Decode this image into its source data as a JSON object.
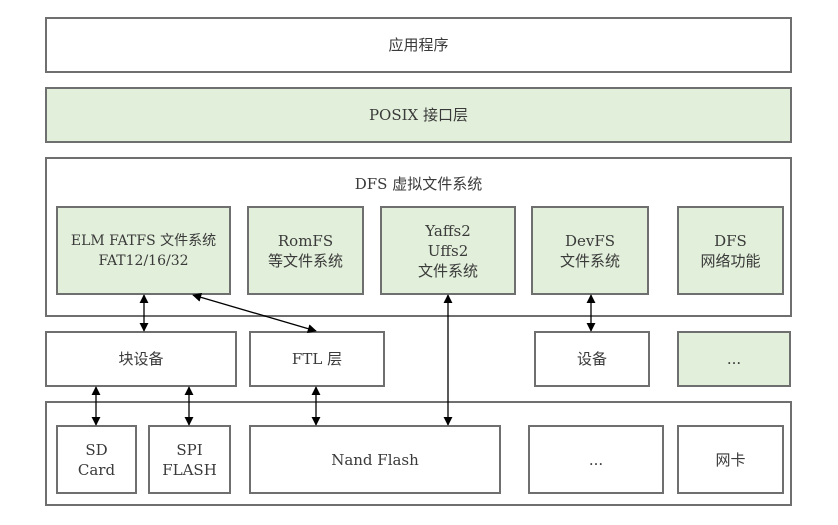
{
  "layers": {
    "application": {
      "label": "应用程序"
    },
    "posix": {
      "label": "POSIX 接口层"
    },
    "dfs": {
      "title": "DFS 虚拟文件系统",
      "filesystems": [
        {
          "label": "ELM FATFS 文件系统\nFAT12/16/32"
        },
        {
          "label": "RomFS\n等文件系统"
        },
        {
          "label": "Yaffs2\nUffs2\n文件系统"
        },
        {
          "label": "DevFS\n文件系统"
        },
        {
          "label": "DFS\n网络功能"
        }
      ]
    },
    "middle": [
      {
        "label": "块设备"
      },
      {
        "label": "FTL 层"
      },
      {
        "label": "设备"
      },
      {
        "label": "..."
      }
    ],
    "hardware": [
      {
        "label": "SD\nCard"
      },
      {
        "label": "SPI\nFLASH"
      },
      {
        "label": "Nand Flash"
      },
      {
        "label": "..."
      },
      {
        "label": "网卡"
      }
    ]
  },
  "connections": [
    {
      "from": "ELM FATFS 文件系统",
      "to": "块设备",
      "type": "bidirectional"
    },
    {
      "from": "ELM FATFS 文件系统",
      "to": "FTL 层",
      "type": "bidirectional"
    },
    {
      "from": "Yaffs2/Uffs2 文件系统",
      "to": "Nand Flash",
      "type": "bidirectional"
    },
    {
      "from": "DevFS 文件系统",
      "to": "设备",
      "type": "bidirectional"
    },
    {
      "from": "块设备",
      "to": "SD Card",
      "type": "bidirectional"
    },
    {
      "from": "块设备",
      "to": "SPI FLASH",
      "type": "bidirectional"
    },
    {
      "from": "FTL 层",
      "to": "Nand Flash",
      "type": "bidirectional"
    }
  ],
  "colors": {
    "highlight_fill": "#e2efda",
    "plain_fill": "#ffffff",
    "border": "#6f6f6f",
    "arrow": "#000000"
  }
}
